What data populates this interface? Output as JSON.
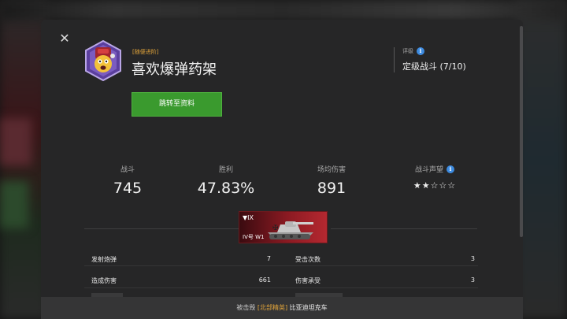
{
  "dialog": {
    "close_glyph": "✕",
    "achievement": {
      "tag": "[随便进阶]",
      "title": "喜欢爆弹药架",
      "goto_button": "跳转至资料"
    },
    "rating": {
      "label": "评级",
      "info_glyph": "i",
      "value": "定级战斗 (7/10)"
    },
    "stats": [
      {
        "label": "战斗",
        "value": "745"
      },
      {
        "label": "胜利",
        "value": "47.83%"
      },
      {
        "label": "场均伤害",
        "value": "891"
      },
      {
        "label": "战斗声望",
        "value": "★★☆☆☆",
        "stars_filled": 2,
        "stars_total": 5,
        "has_info": true
      }
    ],
    "tank": {
      "tier": "▼IX",
      "name": "IV号 W1"
    },
    "details": [
      {
        "label": "发射炮弹",
        "value": "7"
      },
      {
        "label": "受击次数",
        "value": "3"
      },
      {
        "label": "造成伤害",
        "value": "661"
      },
      {
        "label": "伤害承受",
        "value": "3"
      }
    ],
    "footer": {
      "prefix": "被击毁",
      "elite": "[北部精英]",
      "tank": "比亚迪坦克车"
    }
  },
  "colors": {
    "accent_green": "#3a9a2e",
    "info_blue": "#3d8be0",
    "elite_gold": "#e0a33a",
    "tank_red": "#b52830"
  }
}
